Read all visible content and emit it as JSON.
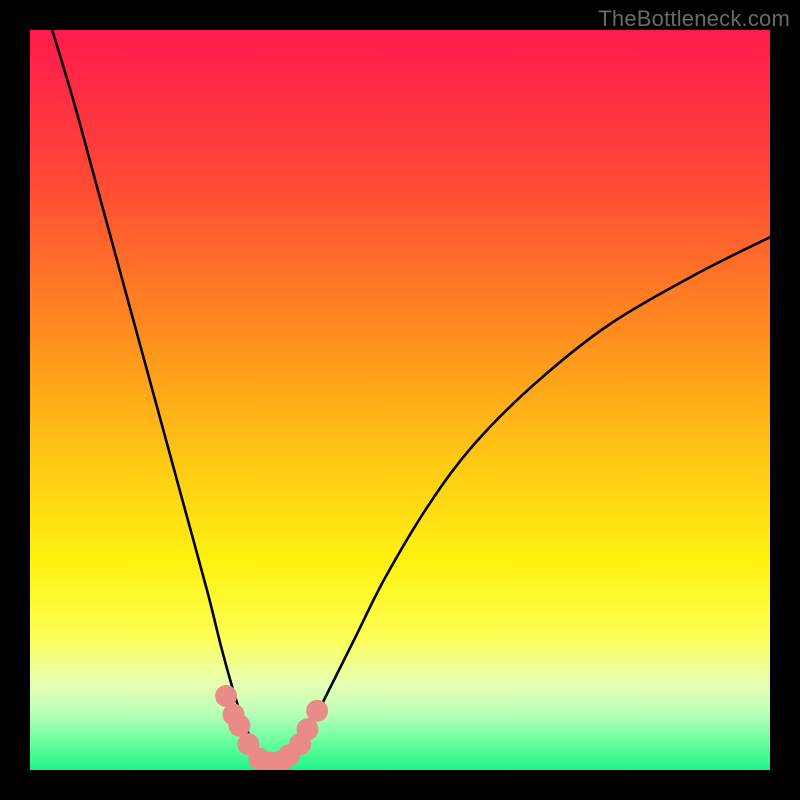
{
  "watermark": "TheBottleneck.com",
  "chart_data": {
    "type": "line",
    "title": "",
    "xlabel": "",
    "ylabel": "",
    "xlim": [
      0,
      100
    ],
    "ylim": [
      0,
      100
    ],
    "grid": false,
    "legend": false,
    "series": [
      {
        "name": "bottleneck-curve",
        "x": [
          3,
          6,
          9,
          12,
          15,
          18,
          21,
          24,
          26,
          28,
          29.5,
          31,
          32.5,
          34,
          36,
          38,
          40,
          44,
          48,
          54,
          60,
          68,
          78,
          90,
          100
        ],
        "y": [
          100,
          90,
          79,
          68,
          57,
          46,
          35,
          24,
          16,
          9,
          5,
          2,
          1,
          1.5,
          3,
          6,
          10,
          18,
          26,
          36,
          44,
          52,
          60,
          67,
          72
        ]
      }
    ],
    "markers": {
      "name": "highlight-points",
      "color": "#e98b87",
      "x": [
        26.5,
        27.5,
        28.3,
        29.5,
        31,
        32.5,
        34,
        35,
        36.5,
        37.5,
        38.8
      ],
      "y": [
        10,
        7.5,
        6,
        3.5,
        1.5,
        1,
        1.2,
        2,
        3.5,
        5.5,
        8
      ]
    },
    "background_gradient": {
      "stops": [
        {
          "pos": 0.0,
          "color": "#ff1a4e"
        },
        {
          "pos": 0.2,
          "color": "#ff4836"
        },
        {
          "pos": 0.4,
          "color": "#ff8a1f"
        },
        {
          "pos": 0.58,
          "color": "#ffc814"
        },
        {
          "pos": 0.72,
          "color": "#fff210"
        },
        {
          "pos": 0.82,
          "color": "#fdff55"
        },
        {
          "pos": 0.88,
          "color": "#e8ffb0"
        },
        {
          "pos": 0.92,
          "color": "#bfffba"
        },
        {
          "pos": 0.96,
          "color": "#6cffa0"
        },
        {
          "pos": 1.0,
          "color": "#1ef58a"
        }
      ]
    }
  }
}
